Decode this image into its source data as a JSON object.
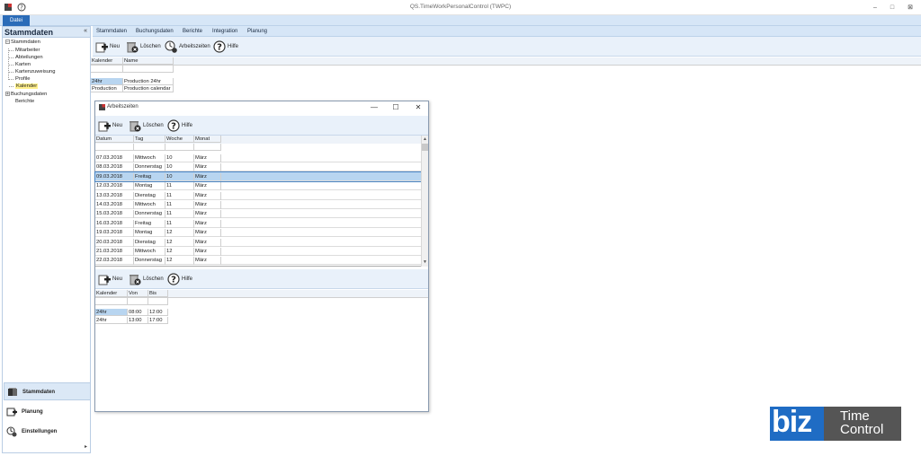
{
  "window": {
    "title": "QS.TimeWorkPersonalControl (TWPC)",
    "file_tab": "Datei",
    "controls": [
      "–",
      "□",
      "⊠"
    ]
  },
  "left_panel": {
    "header": "Stammdaten",
    "collapse_glyph": "«",
    "tree": {
      "root": "Stammdaten",
      "children": [
        "Mitarbeiter",
        "Abteilungen",
        "Karten",
        "Kartenzuweisung",
        "Profile",
        "Kalender"
      ],
      "others": [
        "Buchungsdaten",
        "Berichte"
      ]
    },
    "nav": [
      "Stammdaten",
      "Planung",
      "Einstellungen"
    ],
    "more_glyph": "▸"
  },
  "main": {
    "tabs": [
      "Stammdaten",
      "Buchungsdaten",
      "Berichte",
      "Integration",
      "Planung"
    ],
    "toolbar": {
      "new": "Neu",
      "delete": "Löschen",
      "work_times": "Arbeitszeiten",
      "help": "Hilfe"
    },
    "grid": {
      "columns": [
        "Kalender",
        "Name"
      ],
      "rows": [
        [
          "24hr",
          "Production 24hr"
        ],
        [
          "Production",
          "Production calendar"
        ]
      ]
    }
  },
  "dialog": {
    "title": "Arbeitszeiten",
    "controls": [
      "—",
      "☐",
      "✕"
    ],
    "toolbar": {
      "new": "Neu",
      "delete": "Löschen",
      "help": "Hilfe"
    },
    "grid": {
      "columns": [
        "Datum",
        "Tag",
        "Woche",
        "Monat"
      ],
      "rows": [
        [
          "07.03.2018",
          "Mittwoch",
          "10",
          "März"
        ],
        [
          "08.03.2018",
          "Donnerstag",
          "10",
          "März"
        ],
        [
          "09.03.2018",
          "Freitag",
          "10",
          "März"
        ],
        [
          "12.03.2018",
          "Montag",
          "11",
          "März"
        ],
        [
          "13.03.2018",
          "Dienstag",
          "11",
          "März"
        ],
        [
          "14.03.2018",
          "Mittwoch",
          "11",
          "März"
        ],
        [
          "15.03.2018",
          "Donnerstag",
          "11",
          "März"
        ],
        [
          "16.03.2018",
          "Freitag",
          "11",
          "März"
        ],
        [
          "19.03.2018",
          "Montag",
          "12",
          "März"
        ],
        [
          "20.03.2018",
          "Dienstag",
          "12",
          "März"
        ],
        [
          "21.03.2018",
          "Mittwoch",
          "12",
          "März"
        ],
        [
          "22.03.2018",
          "Donnerstag",
          "12",
          "März"
        ]
      ]
    },
    "toolbar2": {
      "new": "Neu",
      "delete": "Löschen",
      "help": "Hilfe"
    },
    "grid2": {
      "columns": [
        "Kalender",
        "Von",
        "Bis"
      ],
      "rows": [
        [
          "24hr",
          "08:00",
          "12:00"
        ],
        [
          "24hr",
          "13:00",
          "17:00"
        ]
      ]
    }
  },
  "logo": {
    "brand": "biz",
    "line1": "Time",
    "line2": "Control"
  },
  "colors": {
    "accent": "#2b6cb8",
    "ribbon": "#d6e6f7",
    "selection": "#b8d5f0",
    "highlight": "#fff08a",
    "logo_blue": "#1f6cc4",
    "logo_dark": "#555555"
  }
}
